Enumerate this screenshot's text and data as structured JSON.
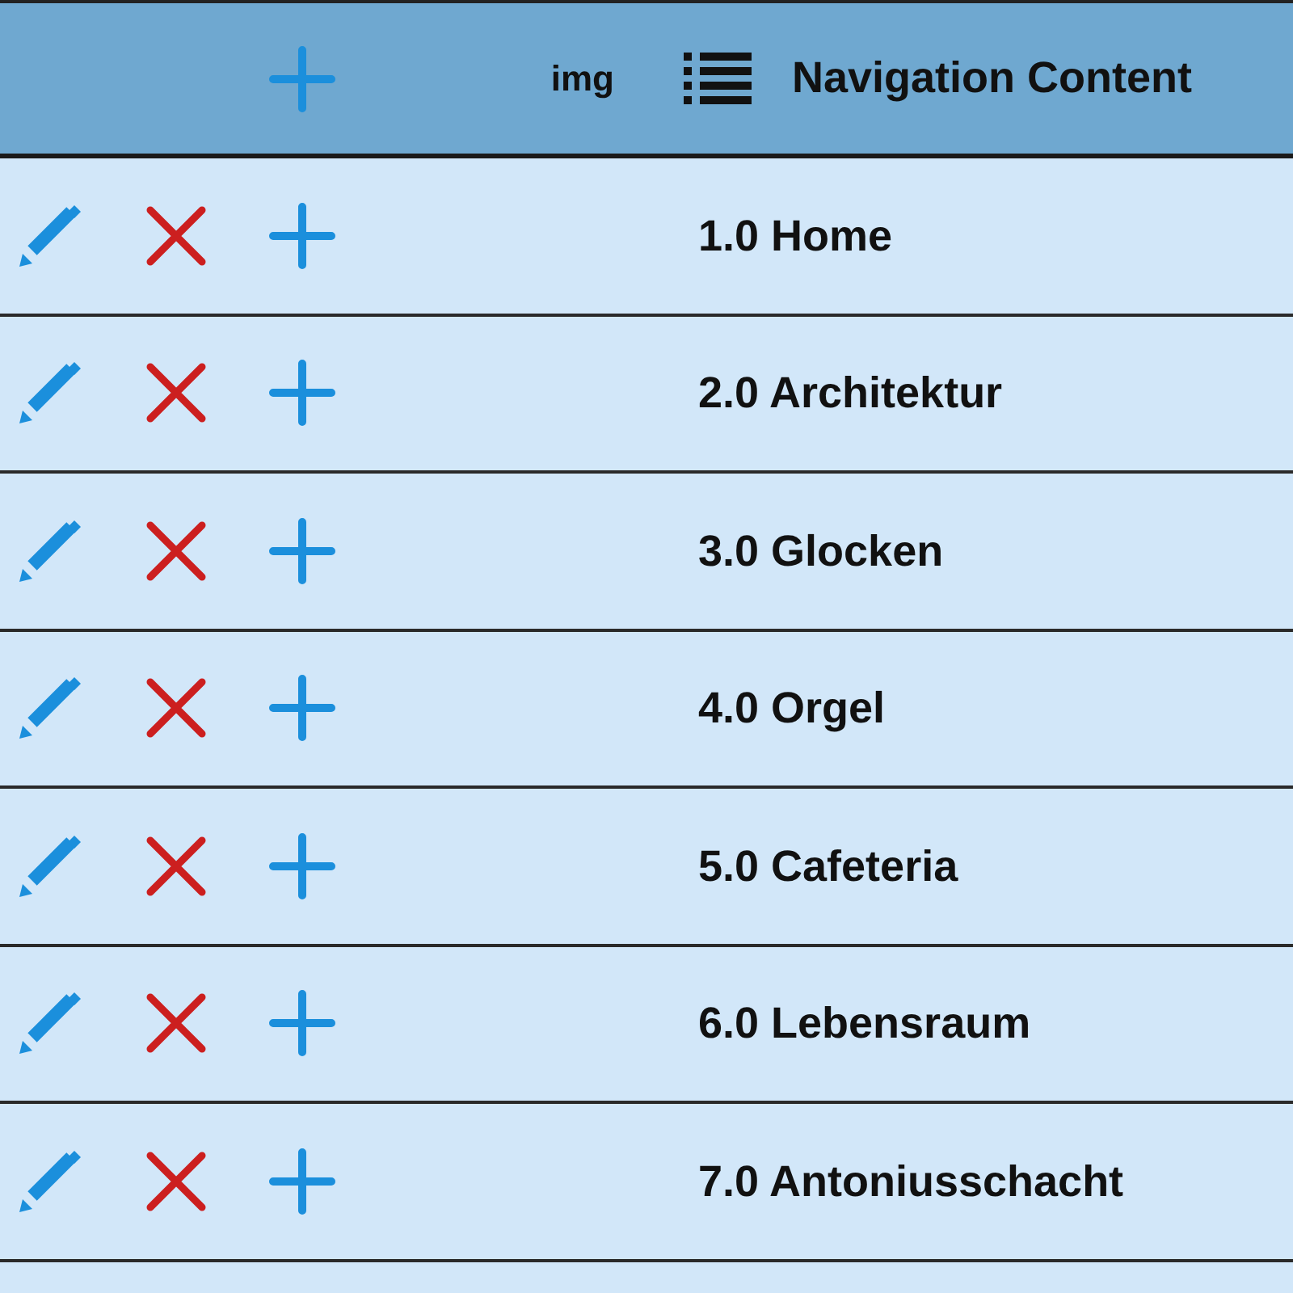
{
  "header": {
    "img_column": "img",
    "content_column": "Navigation Content"
  },
  "rows": [
    {
      "title": "1.0 Home"
    },
    {
      "title": "2.0 Architektur"
    },
    {
      "title": "3.0 Glocken"
    },
    {
      "title": "4.0 Orgel"
    },
    {
      "title": "5.0 Cafeteria"
    },
    {
      "title": "6.0 Lebensraum"
    },
    {
      "title": "7.0 Antoniusschacht"
    }
  ]
}
